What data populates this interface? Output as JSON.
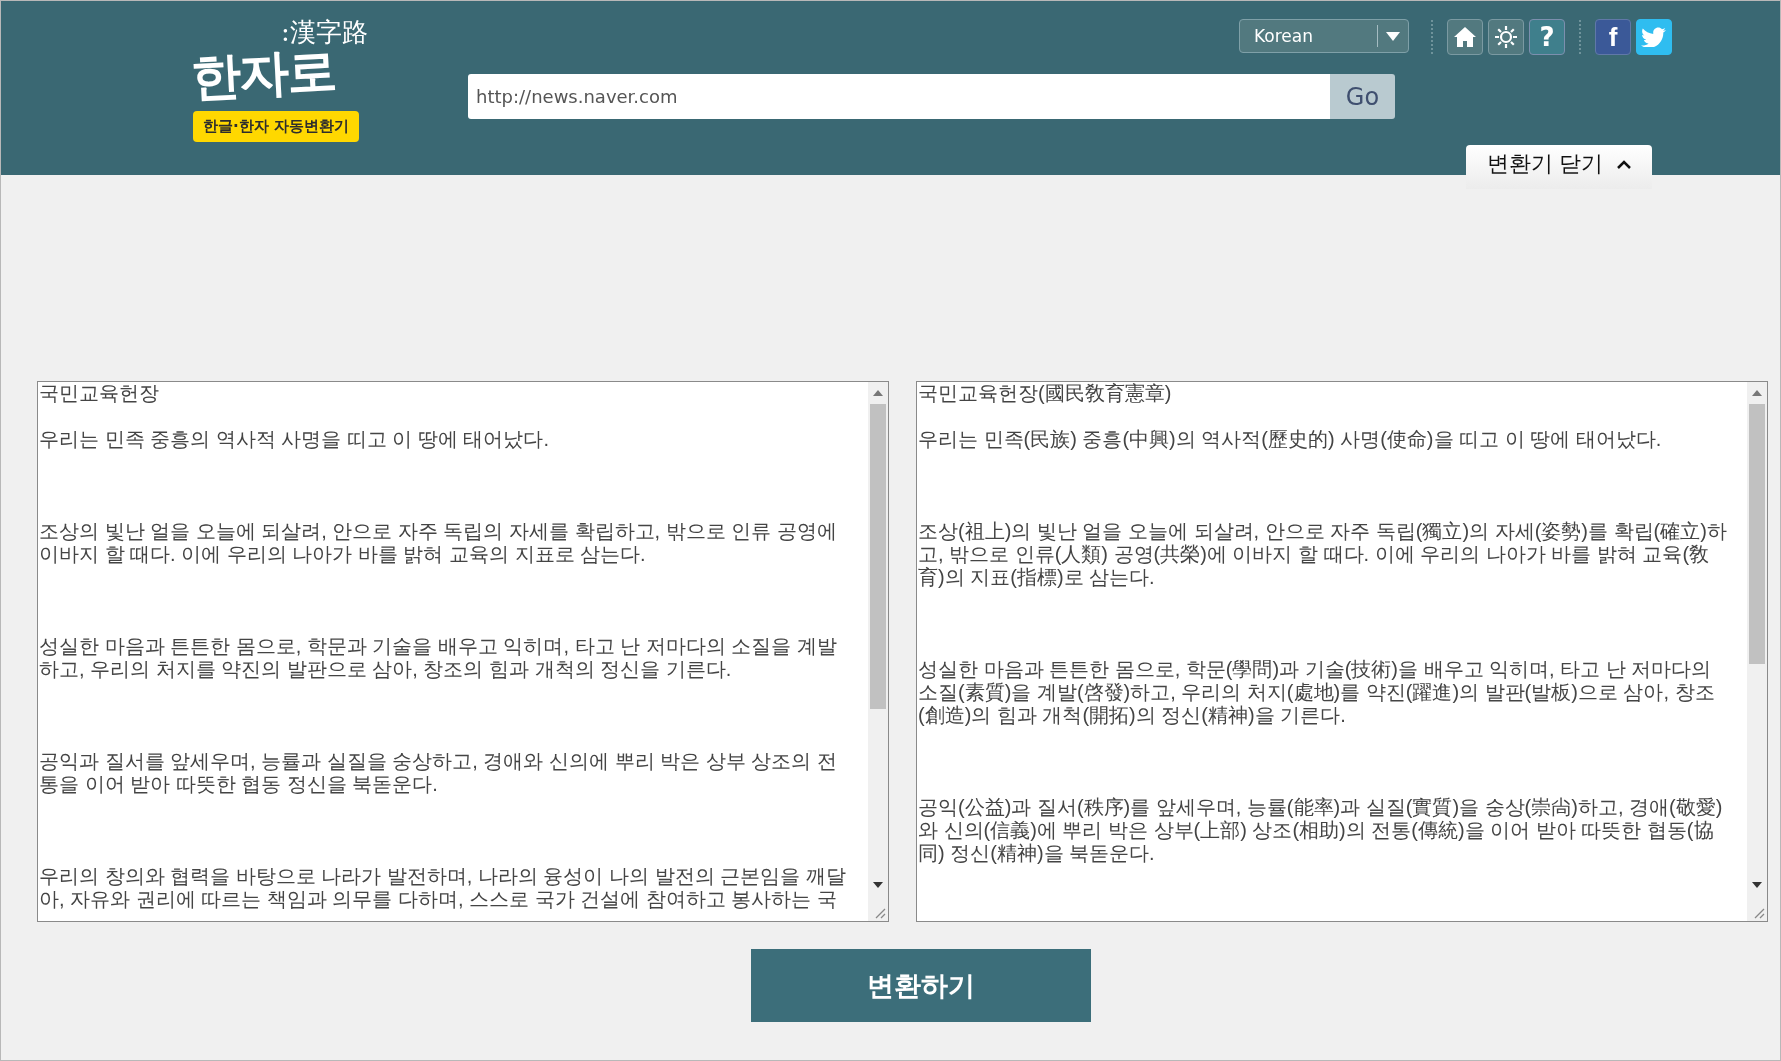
{
  "header": {
    "logo": {
      "hanja": ":漢字路",
      "title": "한자로",
      "tagline": "한글·한자 자동변환기"
    },
    "language_select": {
      "value": "Korean"
    },
    "tool_buttons": [
      {
        "kind": "home"
      },
      {
        "kind": "settings"
      },
      {
        "kind": "help",
        "label": "?"
      }
    ],
    "social_buttons": [
      {
        "kind": "facebook",
        "label": "f"
      },
      {
        "kind": "twitter"
      }
    ],
    "url_field": {
      "value": "http://news.naver.com"
    },
    "go_button": "Go",
    "toggle_tab": {
      "label": "변환기 닫기",
      "expanded": true
    }
  },
  "input_text": {
    "paragraphs": [
      {
        "lines": [
          "국민교육헌장"
        ]
      },
      {
        "lines": [
          "우리는 민족 중흥의 역사적 사명을 띠고 이 땅에 태어났다."
        ]
      },
      {
        "lines": [
          "조상의 빛난 얼을 오늘에 되살려, 안으로 자주 독립의 자세를 확립하고, 밖으로 인류 공영에",
          "이바지 할 때다. 이에 우리의 나아가 바를 밝혀 교육의 지표로 삼는다."
        ]
      },
      {
        "lines": [
          "성실한 마음과 튼튼한 몸으로, 학문과 기술을 배우고 익히며, 타고 난 저마다의 소질을 계발",
          "하고, 우리의 처지를 약진의 발판으로 삼아, 창조의 힘과 개척의 정신을 기른다."
        ]
      },
      {
        "lines": [
          "공익과 질서를 앞세우며, 능률과 실질을 숭상하고, 경애와 신의에 뿌리 박은 상부 상조의 전",
          "통을 이어 받아 따뜻한 협동 정신을 북돋운다."
        ]
      },
      {
        "lines": [
          "우리의 창의와 협력을 바탕으로 나라가 발전하며, 나라의 융성이 나의 발전의 근본임을 깨달",
          "아, 자유와 권리에 따르는 책임과 의무를 다하며, 스스로 국가 건설에 참여하고 봉사하는 국"
        ]
      }
    ]
  },
  "output_text": {
    "paragraphs": [
      {
        "lines": [
          "국민교육헌장(國民敎育憲章)"
        ]
      },
      {
        "lines": [
          "우리는 민족(民族) 중흥(中興)의 역사적(歷史的) 사명(使命)을 띠고 이 땅에 태어났다."
        ]
      },
      {
        "lines": [
          "조상(祖上)의 빛난 얼을 오늘에 되살려, 안으로 자주 독립(獨立)의 자세(姿勢)를 확립(確立)하",
          "고, 밖으로 인류(人類) 공영(共榮)에 이바지 할 때다. 이에 우리의 나아가 바를 밝혀 교육(敎",
          "育)의 지표(指標)로 삼는다."
        ]
      },
      {
        "lines": [
          "성실한 마음과 튼튼한 몸으로, 학문(學問)과 기술(技術)을 배우고 익히며, 타고 난 저마다의",
          "소질(素質)을 계발(啓發)하고, 우리의 처지(處地)를 약진(躍進)의 발판(발板)으로 삼아, 창조",
          "(創造)의 힘과 개척(開拓)의 정신(精神)을 기른다."
        ]
      },
      {
        "lines": [
          "공익(公益)과 질서(秩序)를 앞세우며, 능률(能率)과 실질(實質)을 숭상(崇尙)하고, 경애(敬愛)",
          "와 신의(信義)에 뿌리 박은 상부(上部) 상조(相助)의 전통(傳統)을 이어 받아 따뜻한 협동(協",
          "同) 정신(精神)을 북돋운다."
        ]
      }
    ]
  },
  "convert_button": "변환하기"
}
